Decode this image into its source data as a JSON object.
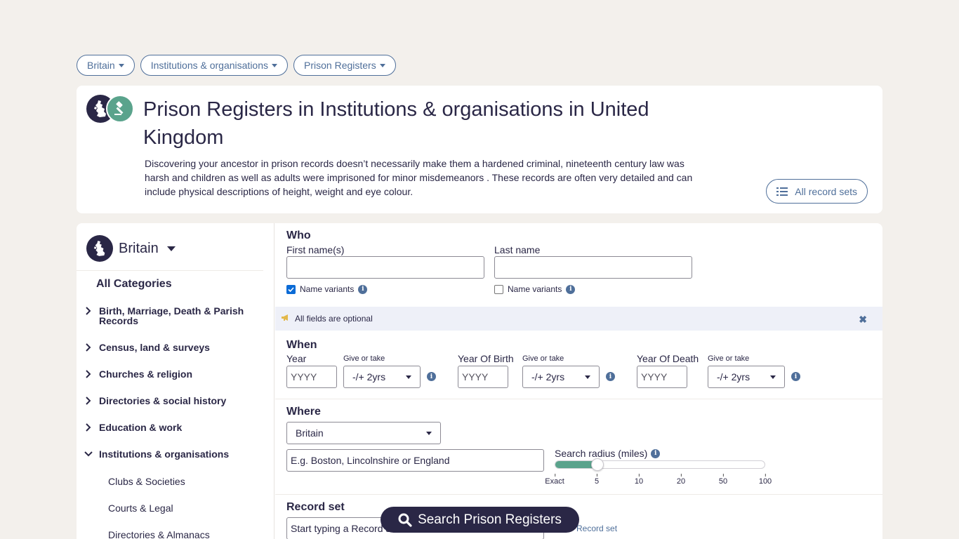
{
  "breadcrumbs": [
    {
      "label": "Britain"
    },
    {
      "label": "Institutions & organisations"
    },
    {
      "label": "Prison Registers"
    }
  ],
  "header": {
    "title": "Prison Registers in Institutions & organisations in United Kingdom",
    "description": "Discovering your ancestor in prison records doesn’t necessarily make them a hardened criminal, nineteenth century law was harsh and children as well as adults were imprisoned for minor misdemeanors . These records are often very detailed and can include physical descriptions of height, weight and eye colour.",
    "all_records_label": "All record sets"
  },
  "sidebar": {
    "country": "Britain",
    "all_categories": "All Categories",
    "categories": [
      {
        "label": "Birth, Marriage, Death & Parish Records",
        "expanded": false
      },
      {
        "label": "Census, land & surveys",
        "expanded": false
      },
      {
        "label": "Churches & religion",
        "expanded": false
      },
      {
        "label": "Directories & social history",
        "expanded": false
      },
      {
        "label": "Education & work",
        "expanded": false
      },
      {
        "label": "Institutions & organisations",
        "expanded": true
      }
    ],
    "subcategories": [
      {
        "label": "Clubs & Societies"
      },
      {
        "label": "Courts & Legal"
      },
      {
        "label": "Directories & Almanacs"
      }
    ]
  },
  "form": {
    "who": {
      "title": "Who",
      "first_name_label": "First name(s)",
      "first_name_value": "",
      "last_name_label": "Last name",
      "last_name_value": "",
      "first_variants_label": "Name variants",
      "first_variants_checked": true,
      "last_variants_label": "Name variants",
      "last_variants_checked": false
    },
    "notice": "All fields are optional",
    "when": {
      "title": "When",
      "year_label": "Year",
      "year_placeholder": "YYYY",
      "birth_label": "Year Of Birth",
      "birth_placeholder": "YYYY",
      "death_label": "Year Of Death",
      "death_placeholder": "YYYY",
      "give_take_label": "Give or take",
      "give_take_value": "-/+ 2yrs"
    },
    "where": {
      "title": "Where",
      "country_value": "Britain",
      "place_placeholder": "E.g. Boston, Lincolnshire or England",
      "radius_label": "Search radius (miles)",
      "radius_value_index": 1,
      "ticks": [
        "Exact",
        "5",
        "10",
        "20",
        "50",
        "100"
      ]
    },
    "record_set": {
      "title": "Record set",
      "placeholder": "Start typing a Record set",
      "side_label": "Record set"
    }
  },
  "search_button": "Search Prison Registers",
  "colors": {
    "navy": "#2a2746",
    "accent_blue": "#4f6f9a",
    "green": "#5aa38c",
    "background": "#f3f0ec"
  }
}
